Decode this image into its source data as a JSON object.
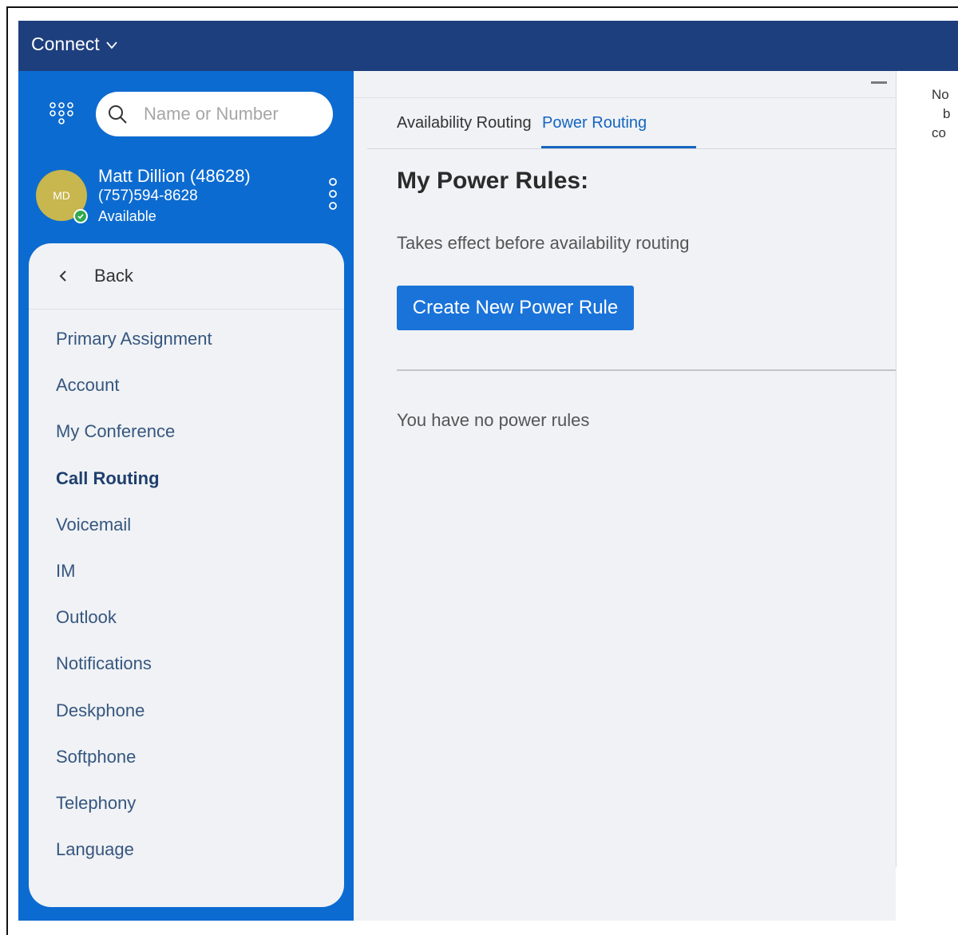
{
  "app": {
    "title": "Connect"
  },
  "search": {
    "placeholder": "Name or Number"
  },
  "profile": {
    "initials": "MD",
    "name": "Matt Dillion (48628)",
    "phone": "(757)594-8628",
    "status": "Available",
    "status_color": "#2fa84f",
    "avatar_color": "#c8b64e"
  },
  "menu": {
    "back_label": "Back",
    "items": [
      {
        "label": "Primary Assignment",
        "active": false
      },
      {
        "label": "Account",
        "active": false
      },
      {
        "label": "My Conference",
        "active": false
      },
      {
        "label": "Call Routing",
        "active": true
      },
      {
        "label": "Voicemail",
        "active": false
      },
      {
        "label": "IM",
        "active": false
      },
      {
        "label": "Outlook",
        "active": false
      },
      {
        "label": "Notifications",
        "active": false
      },
      {
        "label": "Deskphone",
        "active": false
      },
      {
        "label": "Softphone",
        "active": false
      },
      {
        "label": "Telephony",
        "active": false
      },
      {
        "label": "Language",
        "active": false
      }
    ]
  },
  "tabs": [
    {
      "label": "Availability Routing",
      "active": false
    },
    {
      "label": "Power Routing",
      "active": true
    }
  ],
  "main": {
    "heading": "My Power Rules:",
    "subtext": "Takes effect before availability routing",
    "create_button": "Create New Power Rule",
    "empty_message": "You have no power rules"
  },
  "right_panel": {
    "lines": [
      "No",
      "b",
      "co"
    ]
  },
  "colors": {
    "topbar": "#1e3f7e",
    "sidebar": "#0c6bd0",
    "accent": "#1565c0",
    "button": "#1a73d9"
  },
  "icons": [
    "chevron-down-icon",
    "dialpad-icon",
    "search-icon",
    "check-icon",
    "more-vertical-icon",
    "chevron-left-icon",
    "minimize-icon"
  ]
}
